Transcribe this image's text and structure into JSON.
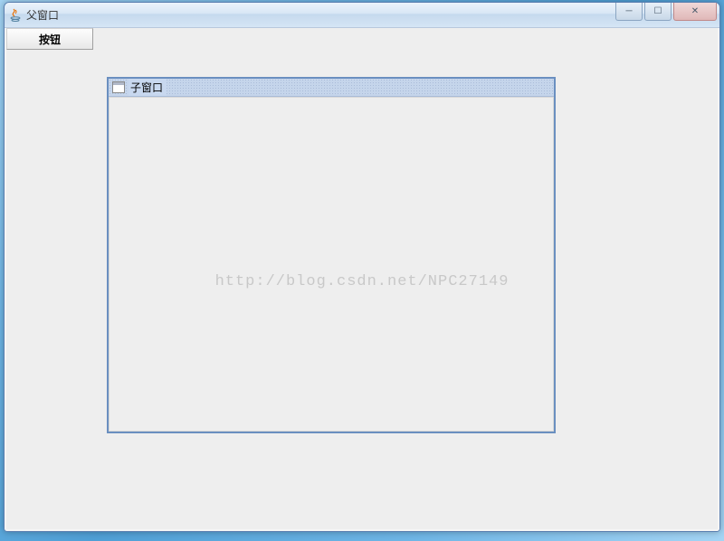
{
  "parent_window": {
    "title": "父窗口",
    "button_label": "按钮"
  },
  "child_window": {
    "title": "子窗口"
  },
  "watermark": "http://blog.csdn.net/NPC27149",
  "window_controls": {
    "minimize": "─",
    "maximize": "☐",
    "close": "✕"
  }
}
